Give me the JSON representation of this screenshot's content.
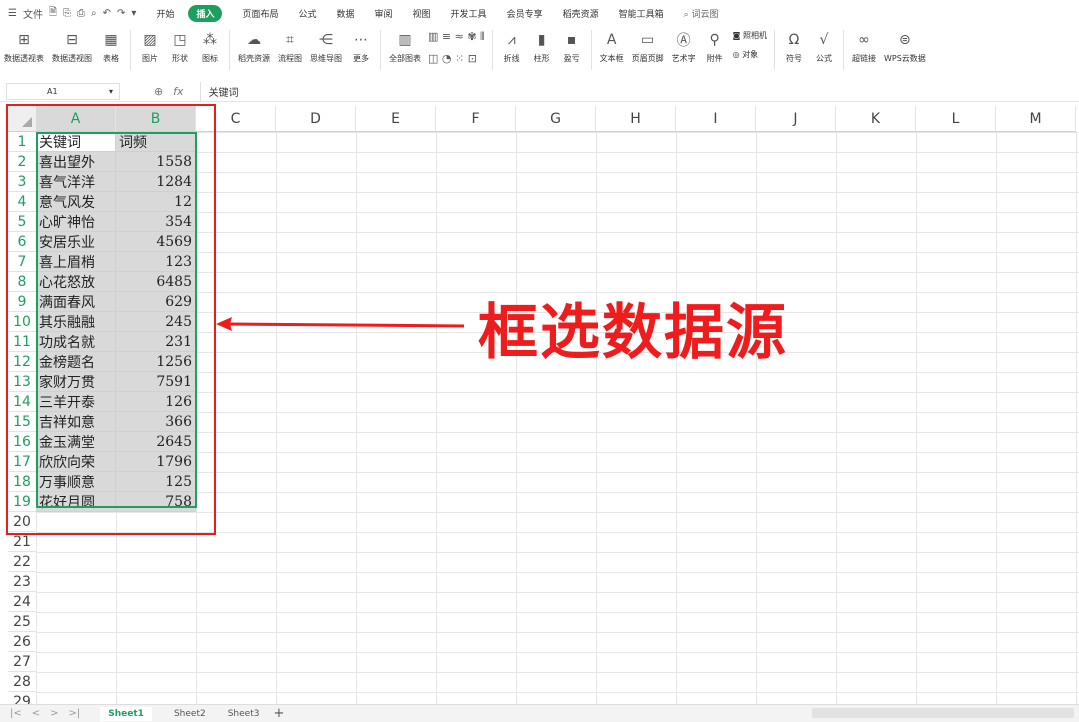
{
  "menubar": {
    "file_label": "文件",
    "tabs": [
      {
        "label": "开始",
        "active": false
      },
      {
        "label": "插入",
        "active": true
      },
      {
        "label": "页面布局",
        "active": false
      },
      {
        "label": "公式",
        "active": false
      },
      {
        "label": "数据",
        "active": false
      },
      {
        "label": "审阅",
        "active": false
      },
      {
        "label": "视图",
        "active": false
      },
      {
        "label": "开发工具",
        "active": false
      },
      {
        "label": "会员专享",
        "active": false
      },
      {
        "label": "稻壳资源",
        "active": false
      },
      {
        "label": "智能工具箱",
        "active": false
      }
    ],
    "search_label": "词云图"
  },
  "ribbon": {
    "pivot_table": "数据透视表",
    "pivot_chart": "数据透视图",
    "table": "表格",
    "picture": "图片",
    "shape": "形状",
    "icon": "图标",
    "daoke": "稻壳资源",
    "flowchart": "流程图",
    "mindmap": "思维导图",
    "more": "更多",
    "all_charts": "全部图表",
    "line": "折线",
    "column": "柱形",
    "winloss": "盈亏",
    "textbox": "文本框",
    "header_footer": "页眉页脚",
    "wordart": "艺术字",
    "attachment": "附件",
    "camera": "照相机",
    "object": "对象",
    "symbol": "符号",
    "formula": "公式",
    "hyperlink": "超链接",
    "wps_cloud": "WPS云数据"
  },
  "formula_bar": {
    "cell_ref": "A1",
    "fx": "fx",
    "content": "关键词"
  },
  "columns": [
    "A",
    "B",
    "C",
    "D",
    "E",
    "F",
    "G",
    "H",
    "I",
    "J",
    "K",
    "L",
    "M"
  ],
  "rows": [
    "1",
    "2",
    "3",
    "4",
    "5",
    "6",
    "7",
    "8",
    "9",
    "10",
    "11",
    "12",
    "13",
    "14",
    "15",
    "16",
    "17",
    "18",
    "19",
    "20",
    "21",
    "22",
    "23",
    "24",
    "25",
    "26",
    "27",
    "28",
    "29"
  ],
  "table": {
    "header": [
      "关键词",
      "词频"
    ],
    "rows": [
      {
        "keyword": "喜出望外",
        "count": "1558"
      },
      {
        "keyword": "喜气洋洋",
        "count": "1284"
      },
      {
        "keyword": "意气风发",
        "count": "12"
      },
      {
        "keyword": "心旷神怡",
        "count": "354"
      },
      {
        "keyword": "安居乐业",
        "count": "4569"
      },
      {
        "keyword": "喜上眉梢",
        "count": "123"
      },
      {
        "keyword": "心花怒放",
        "count": "6485"
      },
      {
        "keyword": "满面春风",
        "count": "629"
      },
      {
        "keyword": "其乐融融",
        "count": "245"
      },
      {
        "keyword": "功成名就",
        "count": "231"
      },
      {
        "keyword": "金榜题名",
        "count": "1256"
      },
      {
        "keyword": "家财万贯",
        "count": "7591"
      },
      {
        "keyword": "三羊开泰",
        "count": "126"
      },
      {
        "keyword": "吉祥如意",
        "count": "366"
      },
      {
        "keyword": "金玉满堂",
        "count": "2645"
      },
      {
        "keyword": "欣欣向荣",
        "count": "1796"
      },
      {
        "keyword": "万事顺意",
        "count": "125"
      },
      {
        "keyword": "花好月圆",
        "count": "758"
      }
    ]
  },
  "annotation": "框选数据源",
  "sheets": [
    {
      "label": "Sheet1",
      "active": true
    },
    {
      "label": "Sheet2",
      "active": false
    },
    {
      "label": "Sheet3",
      "active": false
    }
  ],
  "colors": {
    "accent": "#1f9f5f",
    "annotation": "#ee1c1c",
    "selection_fill": "#d9d9d9"
  }
}
